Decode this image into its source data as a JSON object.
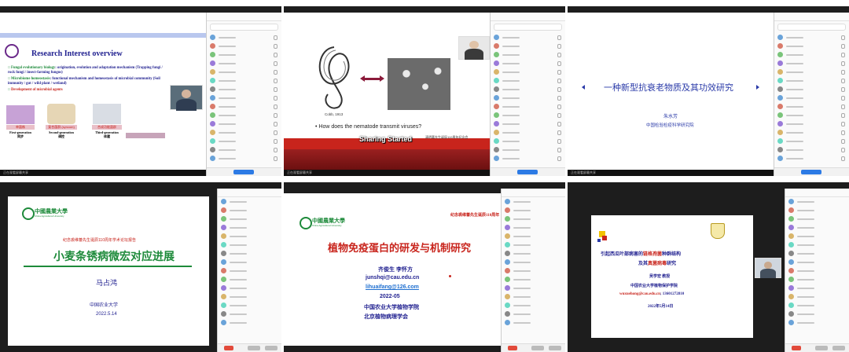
{
  "tiles": {
    "t1": {
      "title": "Research Interest overview",
      "b1_head": "Fungal evolutionary biology",
      "b1_rest": ": origination, evolution and adaptation mechanism (Trapping fungi / rock fungi / insect-farming fungus)",
      "b2_head": "Microbiome homeostasis",
      "b2_rest": ": functional mechanism and homeostasis of microbial community (Soil immunity / gut / wild plant / wetland)",
      "b3": "Development of microbial agents",
      "gen1_tag": "单菌株",
      "gen1_a": "First-generation",
      "gen1_b": "同步",
      "gen2_tag": "复合菌群 (syncom)",
      "gen2_a": "Second-generation",
      "gen2_b": "调控",
      "gen3_tag": "合成功能菌群",
      "gen3_a": "Third-generation",
      "gen3_b": "体建",
      "status": "正在观看屏幕共享"
    },
    "t2": {
      "cite": "Cobb, 1913",
      "bullet": "• How does the nematode transmit viruses?",
      "banner": "Sharing Started",
      "footer": "清明嘉先生诞辰110周年纪念会",
      "status": "正在观看屏幕共享"
    },
    "t3": {
      "title": "一种新型抗衰老物质及其功效研究",
      "author": "朱水芳",
      "org": "中国检验检疫科学研究院",
      "status": "正在观看屏幕共享"
    },
    "t4": {
      "logo": "中國農業大學",
      "logo_en": "China Agricultural University",
      "subtitle": "纪念裘维蕃先生诞辰110周年学术论坛报告",
      "title": "小麦条锈病微宏对应进展",
      "author": "马占鸿",
      "org": "中国农业大学",
      "date": "2022.5.14"
    },
    "t5": {
      "logo": "中國農業大學",
      "logo_en": "China Agricultural University",
      "top_right": "纪念裘维蕃先生诞辰110周年",
      "title": "植物免疫蛋白的研发与机制研究",
      "authors": "齐俊生  李怀方",
      "email1": "junshqi@cau.edu.cn",
      "email2": "lihuaifang@126.com",
      "date": "2022-05",
      "org1": "中国农业大学植物学院",
      "org2": "北京植物病理学会"
    },
    "t6": {
      "title_pre": "引起西瓜叶部病害的",
      "title_hl": "链格孢菌",
      "title_post": "种群结构",
      "line2_pre": "及其",
      "line2_hl": "真菌病毒",
      "line2_post": "研究",
      "author": "吴学宏 教授",
      "org": "中国农业大学植物保护学院",
      "email_label": "wuxuehong@cau.edu.cn",
      "phone": "; 13601272810",
      "date": "2022年5月14日"
    }
  },
  "colors": {
    "navy": "#1f1f8f",
    "red": "#c8241c",
    "green_cau": "#1d8a3a",
    "blue_title": "#2a3aa8",
    "dark_bar": "#1d1d1d"
  }
}
